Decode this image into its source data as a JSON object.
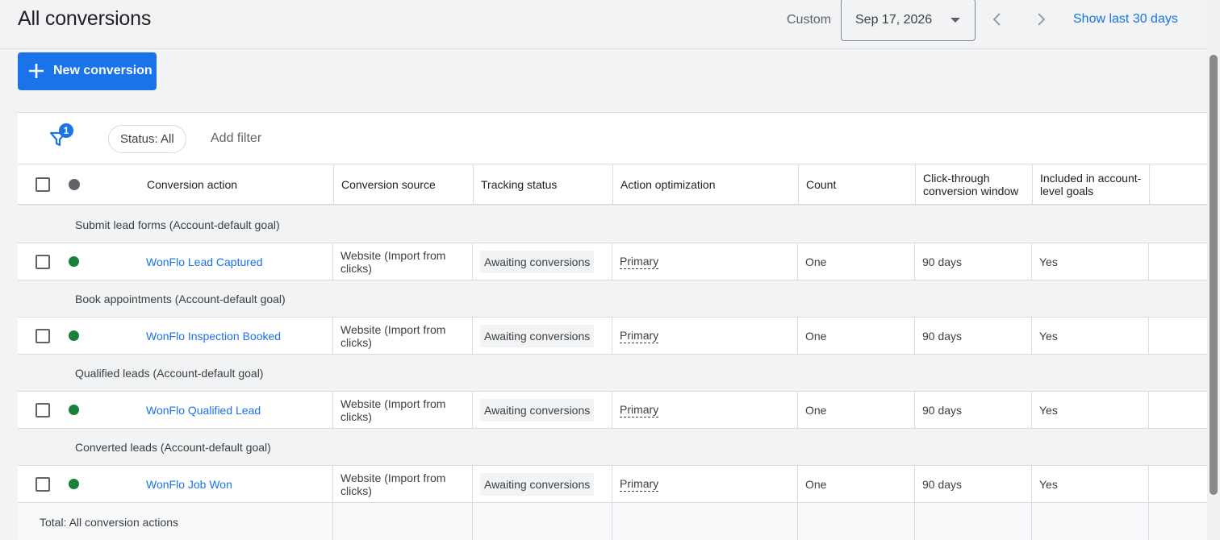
{
  "header": {
    "title": "All conversions",
    "custom_label": "Custom",
    "date_value": "Sep 17, 2026",
    "show_last": "Show last 30 days"
  },
  "toolbar": {
    "new_conversion_label": "New conversion"
  },
  "filters": {
    "badge_count": "1",
    "status_chip": "Status: All",
    "add_filter": "Add filter"
  },
  "table": {
    "columns": {
      "conversion_action": "Conversion action",
      "conversion_source": "Conversion source",
      "tracking_status": "Tracking status",
      "action_optimization": "Action optimization",
      "count": "Count",
      "click_through": "Click-through conversion window",
      "included": "Included in account-level goals"
    },
    "groups": [
      {
        "label": "Submit lead forms (Account-default goal)",
        "row": {
          "action": "WonFlo Lead Captured",
          "source": "Website (Import from clicks)",
          "tracking": "Awaiting conversions",
          "optimization": "Primary",
          "count": "One",
          "window": "90 days",
          "included": "Yes"
        }
      },
      {
        "label": "Book appointments (Account-default goal)",
        "row": {
          "action": "WonFlo Inspection Booked",
          "source": "Website (Import from clicks)",
          "tracking": "Awaiting conversions",
          "optimization": "Primary",
          "count": "One",
          "window": "90 days",
          "included": "Yes"
        }
      },
      {
        "label": "Qualified leads (Account-default goal)",
        "row": {
          "action": "WonFlo Qualified Lead",
          "source": "Website (Import from clicks)",
          "tracking": "Awaiting conversions",
          "optimization": "Primary",
          "count": "One",
          "window": "90 days",
          "included": "Yes"
        }
      },
      {
        "label": "Converted leads (Account-default goal)",
        "row": {
          "action": "WonFlo Job Won",
          "source": "Website (Import from clicks)",
          "tracking": "Awaiting conversions",
          "optimization": "Primary",
          "count": "One",
          "window": "90 days",
          "included": "Yes"
        }
      }
    ],
    "total_label": "Total: All conversion actions"
  },
  "colors": {
    "accent": "#1a73e8",
    "status_enabled": "#188038",
    "background": "#f1f3f4"
  },
  "icons": {
    "add": "plus-icon",
    "filter": "filter-icon",
    "prev": "chevron-left-icon",
    "next": "chevron-right-icon",
    "dropdown": "caret-down-icon"
  }
}
